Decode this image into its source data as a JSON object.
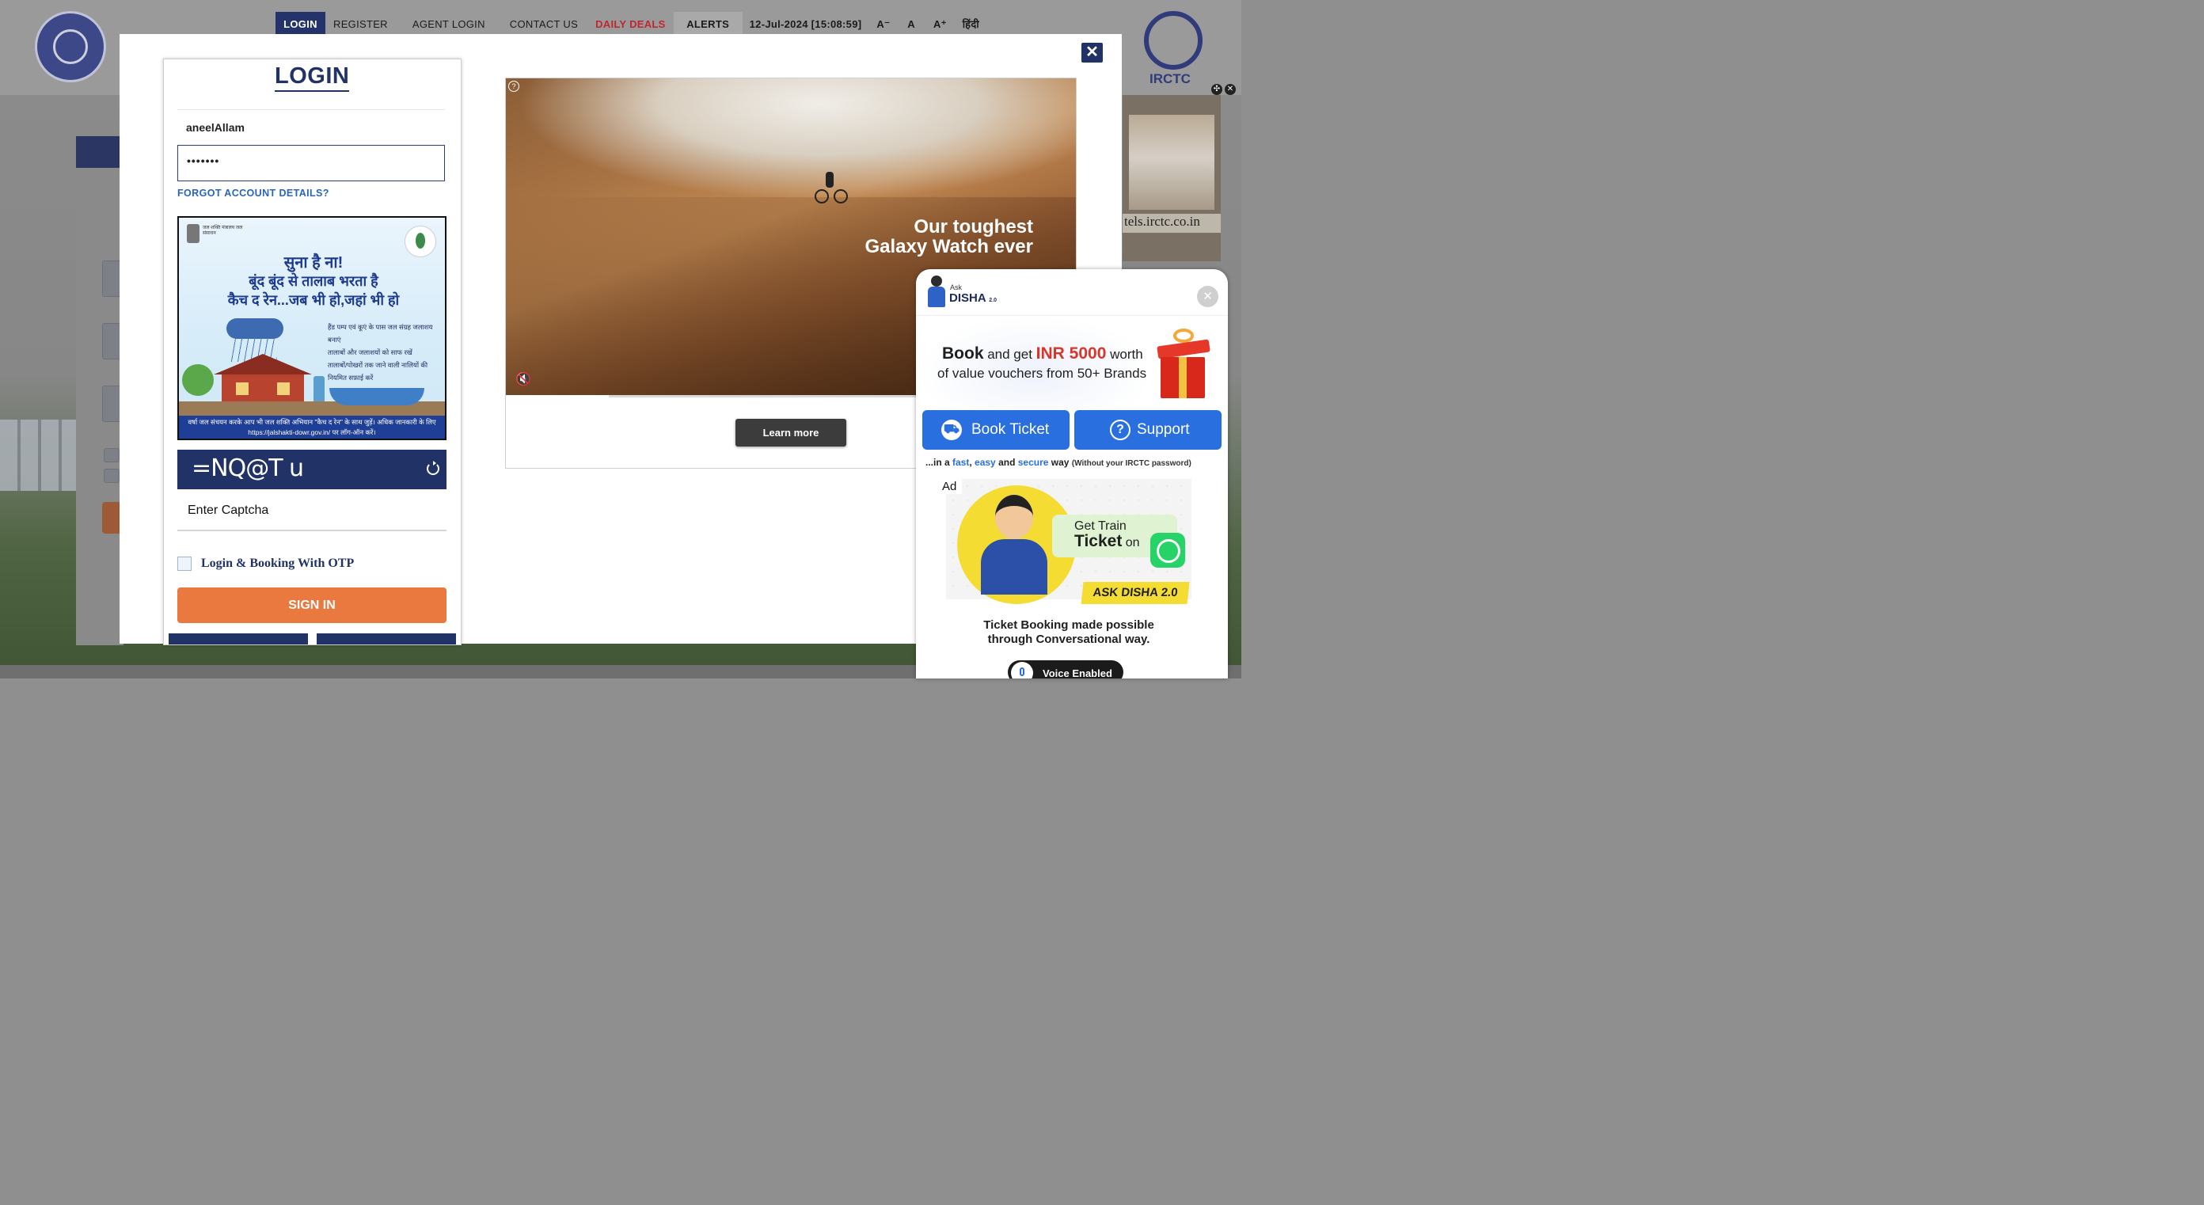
{
  "nav": {
    "items": [
      {
        "label": "LOGIN"
      },
      {
        "label": "REGISTER"
      },
      {
        "label": "AGENT LOGIN"
      },
      {
        "label": "CONTACT US"
      },
      {
        "label": "DAILY DEALS"
      },
      {
        "label": "ALERTS"
      }
    ],
    "datetime": "12-Jul-2024 [15:08:59]",
    "font_small": "A⁻",
    "font_normal": "A",
    "font_large": "A⁺",
    "hindi": "हिंदी"
  },
  "branding": {
    "irctc_logo_text": "IRCTC"
  },
  "background_ad": {
    "url_text": "tels.irctc.co.in"
  },
  "modal": {
    "close_icon": "close-icon",
    "login": {
      "title": "LOGIN",
      "username_value": "aneelAllam",
      "password_value": "•••••••",
      "forgot_link": "FORGOT ACCOUNT DETAILS?",
      "captcha_text": "=NQ@T u",
      "captcha_placeholder": "Enter Captcha",
      "otp_label": "Login & Booking With OTP",
      "sign_in_label": "SIGN IN"
    },
    "jal_ad": {
      "ministry": "जल शक्ति मंत्रालय जल संसाधन",
      "line1": "सुना है ना!",
      "line2": "बूंद बूंद से तालाब भरता है",
      "line3": "कैच द रेन...जब भी हो,जहां भी हो",
      "bullet1": "हैंड पम्प एवं कूएं के पास जल संग्रह जलाशय बनाएं",
      "bullet2": "तालाबों और जलाशयों को साफ रखें",
      "bullet3": "तालाबों/पोखरों तक जाने वाली नालियों की नियमित सफ़ाई करें",
      "footer": "वर्षा जल संचयन करके आप भी जल शक्ति अभियान \"कैच द रेन\" के साथ जुड़ें। अधिक जानकारी के लिए https://jalshakti-dowr.gov.in/ पर लॉग-ऑन करें।"
    },
    "video_ad": {
      "headline_1": "Our toughest",
      "headline_2": "Galaxy Watch ever",
      "learn_more": "Learn more",
      "progress": 0.18
    }
  },
  "disha": {
    "ask": "Ask",
    "name": "DISHA",
    "version": "2.0",
    "promo_book": "Book",
    "promo_and_get": " and get ",
    "promo_amount": "INR 5000",
    "promo_worth": " worth",
    "promo_line2": "of value vouchers from 50+ Brands",
    "book_ticket": "Book Ticket",
    "support": "Support",
    "way_prefix": "...in a ",
    "way_fast": "fast",
    "way_easy": "easy",
    "way_and": " and ",
    "way_secure": "secure",
    "way_suffix": " way",
    "way_note": "(Without your IRCTC password)",
    "ad_tag": "Ad",
    "ad_get": "Get Train",
    "ad_ticket": "Ticket",
    "ad_on": " on",
    "ad_disha": "ASK DISHA 2.0",
    "ad_desc1": "Ticket Booking made possible",
    "ad_desc2": "through Conversational way.",
    "voice": "Voice Enabled"
  }
}
